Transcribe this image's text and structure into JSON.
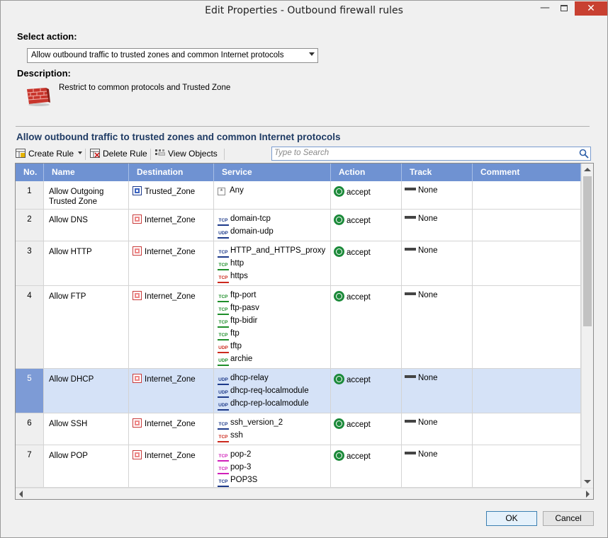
{
  "window": {
    "title": "Edit Properties - Outbound firewall rules"
  },
  "select_action": {
    "label": "Select action:",
    "value": "Allow outbound traffic to trusted zones and common Internet protocols"
  },
  "description": {
    "label": "Description:",
    "text": "Restrict to common protocols and Trusted Zone",
    "icon": "brick-wall-icon"
  },
  "section": {
    "title": "Allow outbound traffic to trusted zones and common Internet protocols"
  },
  "toolbar": {
    "create_rule": "Create Rule",
    "delete_rule": "Delete Rule",
    "view_objects": "View Objects"
  },
  "search": {
    "placeholder": "Type to Search"
  },
  "table": {
    "columns": [
      "No.",
      "Name",
      "Destination",
      "Service",
      "Action",
      "Track",
      "Comment"
    ],
    "rows": [
      {
        "no": "1",
        "name_lines": [
          "Allow Outgoing",
          "Trusted Zone"
        ],
        "destination": "Trusted_Zone",
        "dest_icon": "trusted-zone-icon",
        "services": [
          {
            "proto": "any",
            "name": "Any"
          }
        ],
        "action": "accept",
        "track": "None",
        "comment": ""
      },
      {
        "no": "2",
        "name_lines": [
          "Allow DNS"
        ],
        "destination": "Internet_Zone",
        "dest_icon": "internet-zone-icon",
        "services": [
          {
            "proto": "TCP",
            "color": "blue",
            "name": "domain-tcp"
          },
          {
            "proto": "UDP",
            "color": "blue",
            "name": "domain-udp"
          }
        ],
        "action": "accept",
        "track": "None",
        "comment": ""
      },
      {
        "no": "3",
        "name_lines": [
          "Allow HTTP"
        ],
        "destination": "Internet_Zone",
        "dest_icon": "internet-zone-icon",
        "services": [
          {
            "proto": "TCP",
            "color": "blue",
            "name": "HTTP_and_HTTPS_proxy"
          },
          {
            "proto": "TCP",
            "color": "green",
            "name": "http"
          },
          {
            "proto": "TCP",
            "color": "red",
            "name": "https"
          }
        ],
        "action": "accept",
        "track": "None",
        "comment": ""
      },
      {
        "no": "4",
        "name_lines": [
          "Allow FTP"
        ],
        "destination": "Internet_Zone",
        "dest_icon": "internet-zone-icon",
        "services": [
          {
            "proto": "TCP",
            "color": "green",
            "name": "ftp-port"
          },
          {
            "proto": "TCP",
            "color": "green",
            "name": "ftp-pasv"
          },
          {
            "proto": "TCP",
            "color": "green",
            "name": "ftp-bidir"
          },
          {
            "proto": "TCP",
            "color": "green",
            "name": "ftp"
          },
          {
            "proto": "UDP",
            "color": "red",
            "name": "tftp"
          },
          {
            "proto": "UDP",
            "color": "green",
            "name": "archie"
          }
        ],
        "action": "accept",
        "track": "None",
        "comment": ""
      },
      {
        "no": "5",
        "name_lines": [
          "Allow DHCP"
        ],
        "destination": "Internet_Zone",
        "dest_icon": "internet-zone-icon",
        "selected": true,
        "services": [
          {
            "proto": "UDP",
            "color": "blue",
            "name": "dhcp-relay"
          },
          {
            "proto": "UDP",
            "color": "blue",
            "name": "dhcp-req-localmodule"
          },
          {
            "proto": "UDP",
            "color": "blue",
            "name": "dhcp-rep-localmodule"
          }
        ],
        "action": "accept",
        "track": "None",
        "comment": ""
      },
      {
        "no": "6",
        "name_lines": [
          "Allow SSH"
        ],
        "destination": "Internet_Zone",
        "dest_icon": "internet-zone-icon",
        "services": [
          {
            "proto": "TCP",
            "color": "blue",
            "name": "ssh_version_2"
          },
          {
            "proto": "TCP",
            "color": "red",
            "name": "ssh"
          }
        ],
        "action": "accept",
        "track": "None",
        "comment": ""
      },
      {
        "no": "7",
        "name_lines": [
          "Allow POP"
        ],
        "destination": "Internet_Zone",
        "dest_icon": "internet-zone-icon",
        "services": [
          {
            "proto": "TCP",
            "color": "magenta",
            "name": "pop-2"
          },
          {
            "proto": "TCP",
            "color": "magenta",
            "name": "pop-3"
          },
          {
            "proto": "TCP",
            "color": "blue",
            "name": "POP3S"
          }
        ],
        "action": "accept",
        "track": "None",
        "comment": ""
      }
    ]
  },
  "buttons": {
    "ok": "OK",
    "cancel": "Cancel"
  },
  "colors": {
    "header_bg": "#6f92d2",
    "selected_row": "#d5e2f7",
    "accept_green": "#1c8a3a",
    "close_red": "#c84031"
  }
}
